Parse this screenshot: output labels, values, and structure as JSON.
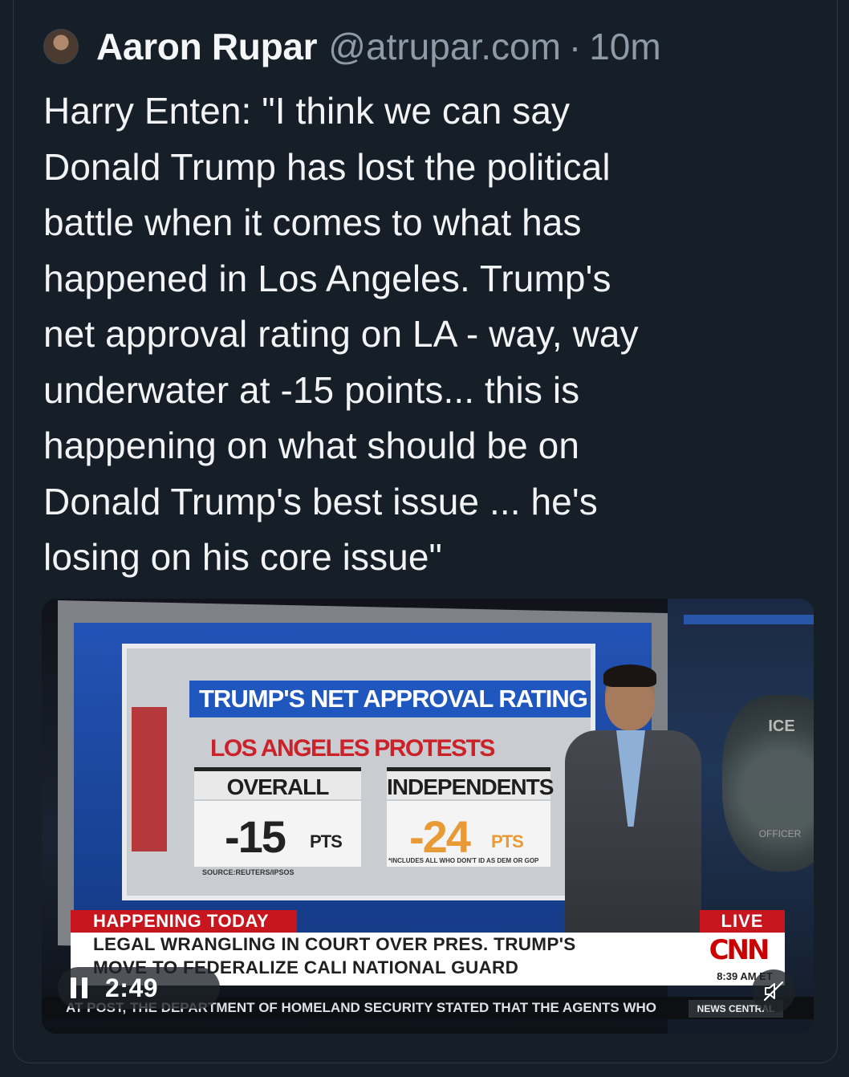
{
  "post": {
    "author": "Aaron Rupar",
    "handle": "@atrupar.com",
    "separator": "·",
    "time": "10m",
    "text": "Harry Enten: \"I think we can say\nDonald Trump has lost the political\nbattle when it comes to what has\nhappened in Los Angeles. Trump's\nnet approval rating on LA - way, way\nunderwater at -15 points... this is\nhappening on what should be on\nDonald Trump's best issue ... he's\nlosing on his core issue\""
  },
  "video": {
    "graphic": {
      "title": "TRUMP'S NET APPROVAL RATING",
      "subtitle": "LOS ANGELES PROTESTS",
      "col_overall": "OVERALL",
      "col_independents": "INDEPENDENTS",
      "overall_value": "-15",
      "overall_unit": "PTS",
      "independents_value": "-24",
      "independents_unit": "PTS",
      "source": "SOURCE:REUTERS/IPSOS",
      "note": "*INCLUDES ALL WHO DON'T ID AS DEM OR GOP"
    },
    "badge_text": "ICE",
    "badge_officer": "OFFICER",
    "lower_third": {
      "tag": "HAPPENING TODAY",
      "live": "LIVE",
      "headline_line1": "LEGAL WRANGLING IN COURT OVER PRES. TRUMP'S",
      "headline_line2": "MOVE TO FEDERALIZE CALI NATIONAL GUARD",
      "network": "CNN",
      "clock": "8:39 AM ET",
      "ticker": "AT POST, THE DEPARTMENT OF HOMELAND SECURITY STATED THAT THE AGENTS WHO",
      "ticker_tag": "NEWS CENTRAL"
    },
    "controls": {
      "duration": "2:49",
      "pause_icon": "pause-icon",
      "mute_icon": "muted-speaker-icon"
    }
  }
}
